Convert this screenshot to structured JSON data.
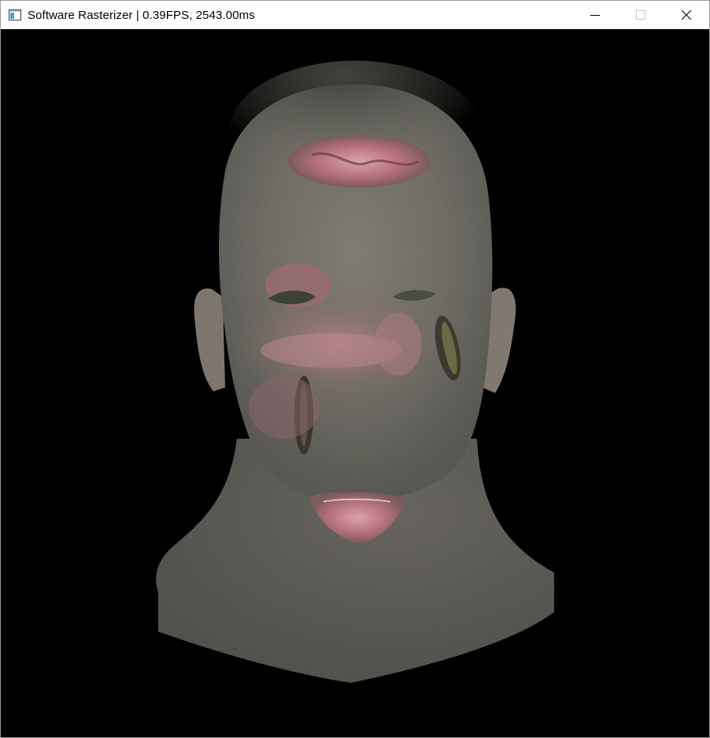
{
  "window": {
    "title": "Software Rasterizer | 0.39FPS, 2543.00ms",
    "icon": "app-window-icon",
    "controls": {
      "minimize": "minimize-icon",
      "maximize": "maximize-icon",
      "close": "close-icon"
    }
  },
  "viewport": {
    "background": "#000000",
    "render": "textured-3d-head-model"
  },
  "colors": {
    "skin_base": "#6f6a62",
    "skin_dark": "#3c3d36",
    "skin_pink": "#a86a78",
    "scalp_dark": "#4a4d45"
  }
}
